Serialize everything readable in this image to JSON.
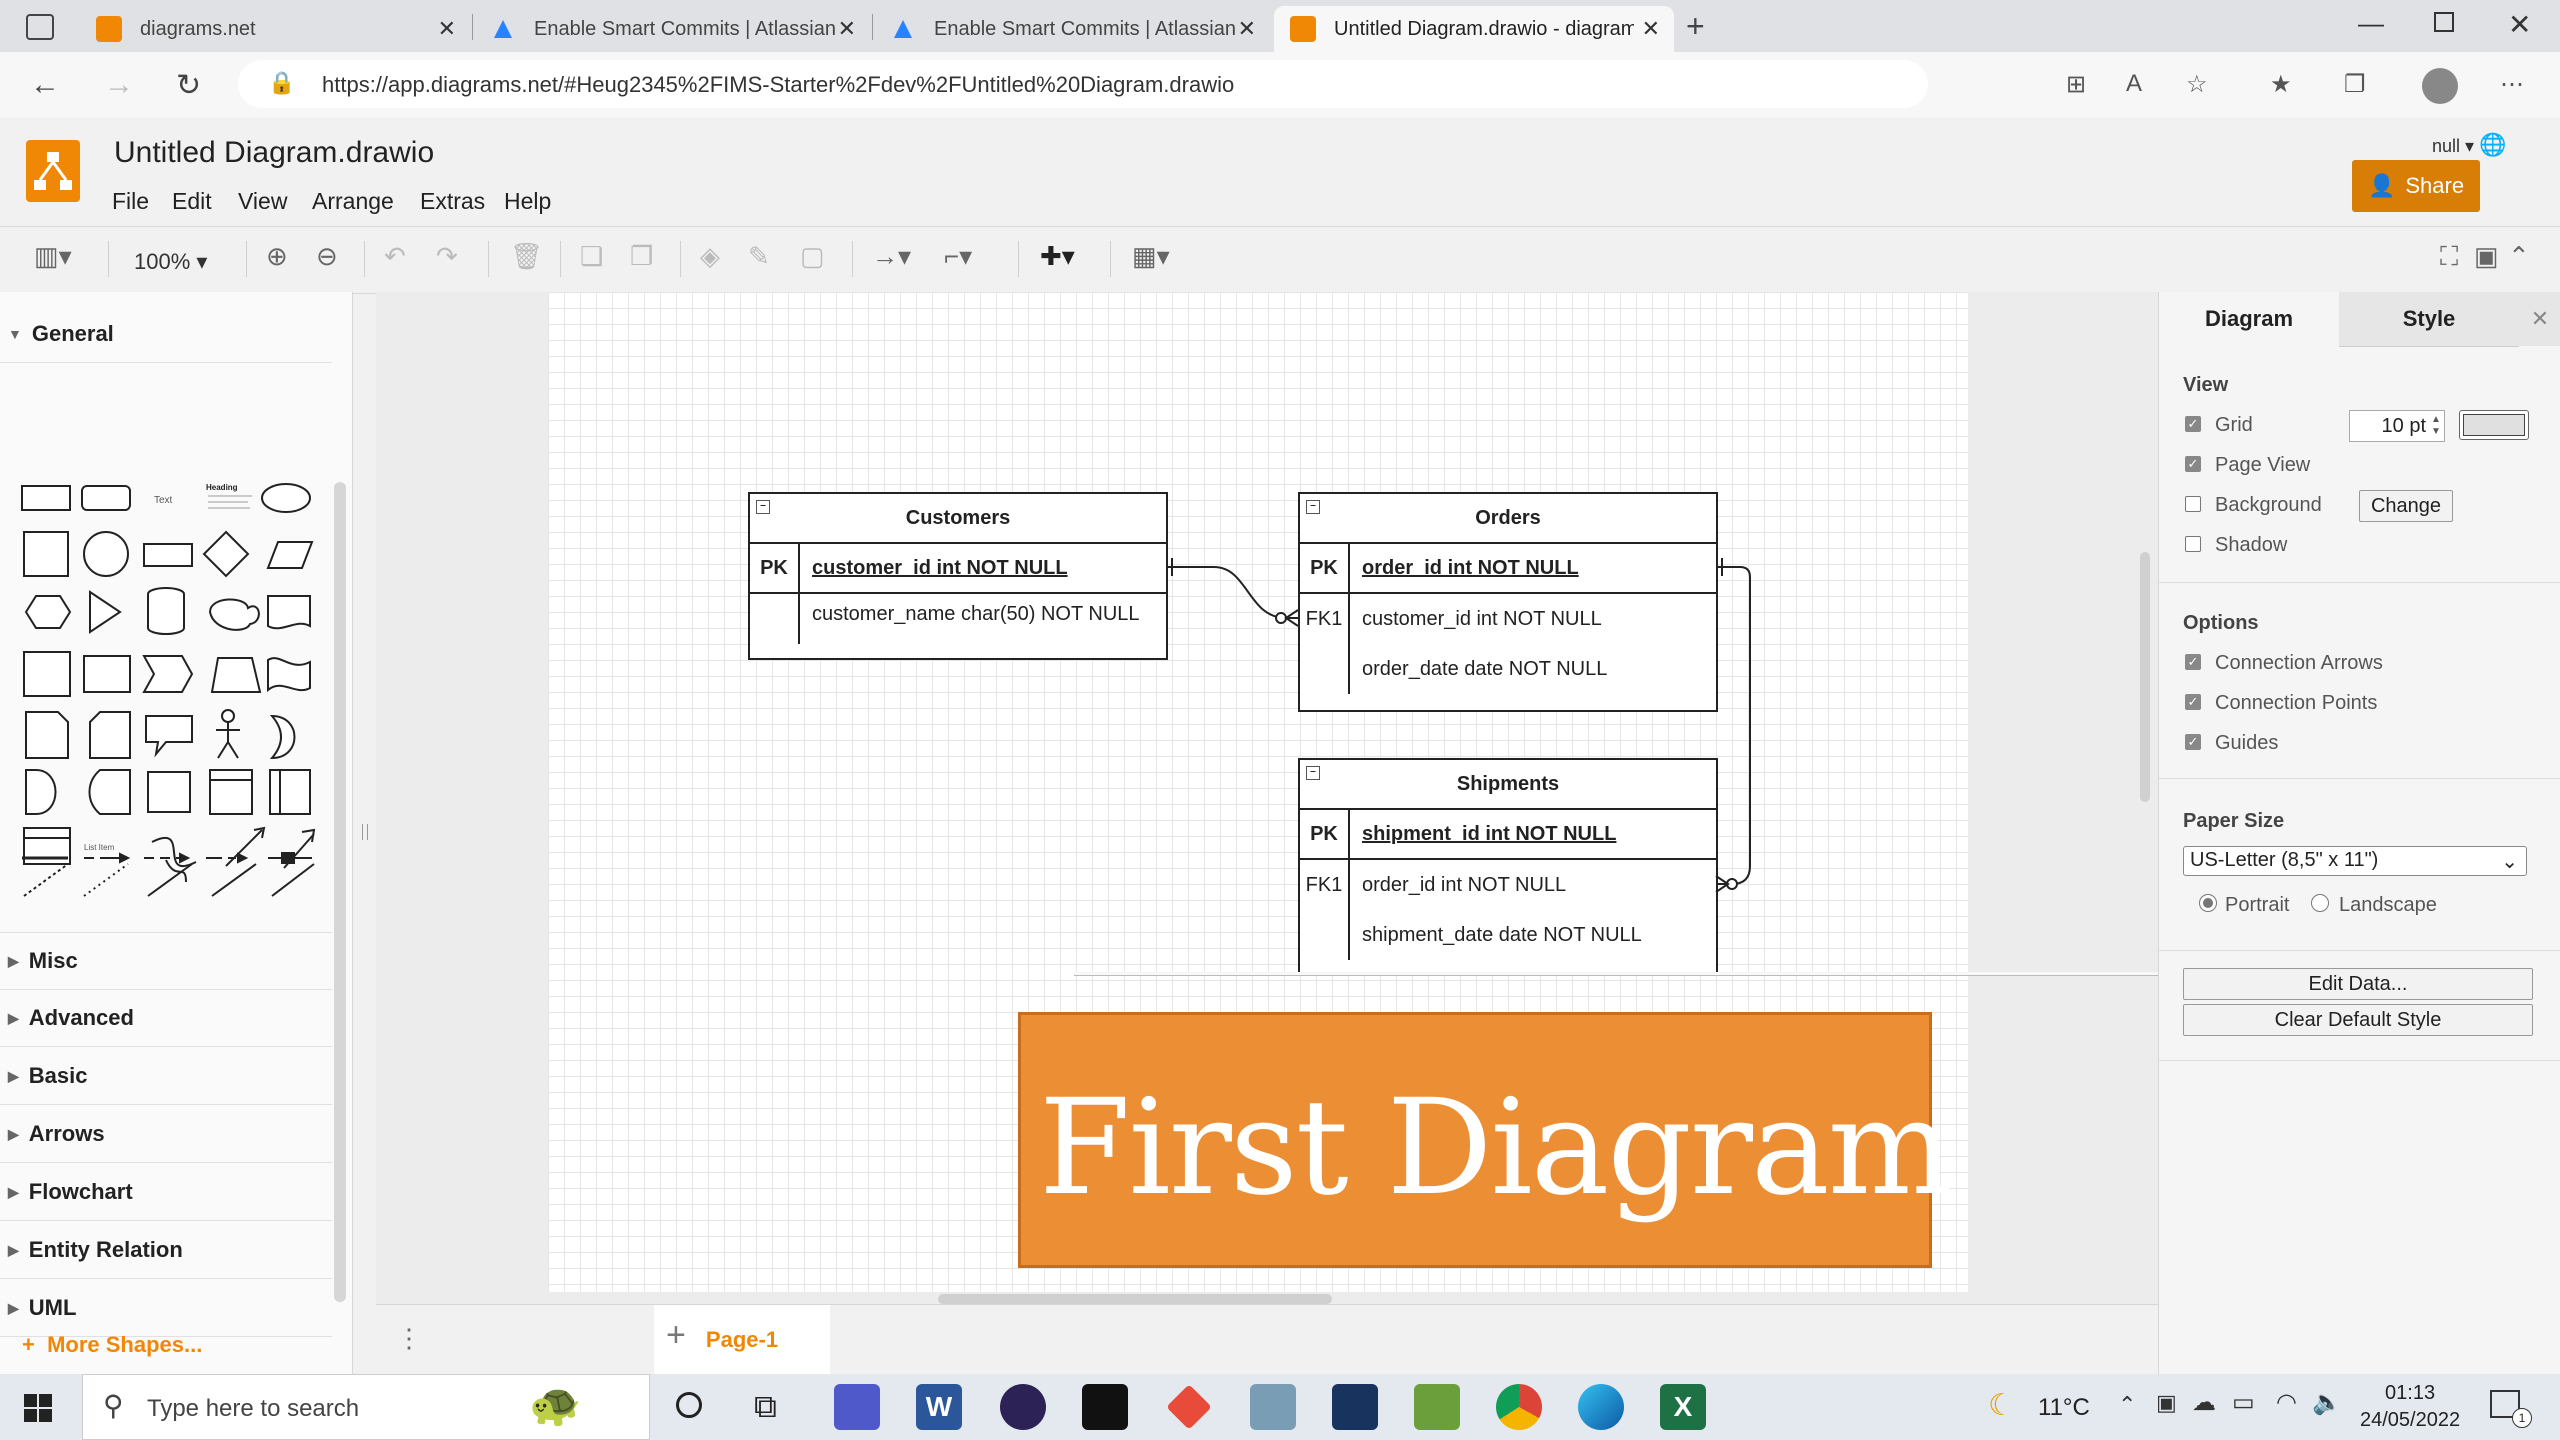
{
  "browser": {
    "tabs": [
      {
        "label": "diagrams.net",
        "active": false
      },
      {
        "label": "Enable Smart Commits | Atlassian",
        "active": false
      },
      {
        "label": "Enable Smart Commits | Atlassian",
        "active": false
      },
      {
        "label": "Untitled Diagram.drawio - diagrams",
        "active": true
      }
    ],
    "url": "https://app.diagrams.net/#Heug2345%2FIMS-Starter%2Fdev%2FUntitled%20Diagram.drawio"
  },
  "app": {
    "title": "Untitled Diagram.drawio",
    "menu": [
      "File",
      "Edit",
      "View",
      "Arrange",
      "Extras",
      "Help"
    ],
    "share_label": "Share",
    "language_selector": "null",
    "zoom": "100%"
  },
  "sidebar": {
    "sections": [
      "General",
      "Misc",
      "Advanced",
      "Basic",
      "Arrows",
      "Flowchart",
      "Entity Relation",
      "UML"
    ],
    "more_shapes": "More Shapes...",
    "shape_text_sample": "Text",
    "shape_heading_sample": "Heading",
    "shape_list_sample": "List Item"
  },
  "diagram": {
    "tables": [
      {
        "name": "Customers",
        "rows": [
          {
            "key": "PK",
            "field": "customer_id int NOT NULL",
            "primary": true
          },
          {
            "key": "",
            "field": "customer_name char(50) NOT NULL",
            "primary": false
          }
        ]
      },
      {
        "name": "Orders",
        "rows": [
          {
            "key": "PK",
            "field": "order_id int NOT NULL",
            "primary": true
          },
          {
            "key": "FK1",
            "field": "customer_id int NOT NULL",
            "primary": false
          },
          {
            "key": "",
            "field": "order_date date NOT NULL",
            "primary": false
          }
        ]
      },
      {
        "name": "Shipments",
        "rows": [
          {
            "key": "PK",
            "field": "shipment_id int NOT NULL",
            "primary": true
          },
          {
            "key": "FK1",
            "field": "order_id int NOT NULL",
            "primary": false
          },
          {
            "key": "",
            "field": "shipment_date date NOT NULL",
            "primary": false
          }
        ]
      }
    ],
    "banner_text": "First Diagram",
    "banner_color": "#ec8f34"
  },
  "right_panel": {
    "tabs": [
      "Diagram",
      "Style"
    ],
    "view_heading": "View",
    "view_options": [
      {
        "label": "Grid",
        "checked": true
      },
      {
        "label": "Page View",
        "checked": true
      },
      {
        "label": "Background",
        "checked": false
      },
      {
        "label": "Shadow",
        "checked": false
      }
    ],
    "grid_size": "10 pt",
    "background_button": "Change",
    "options_heading": "Options",
    "options": [
      {
        "label": "Connection Arrows",
        "checked": true
      },
      {
        "label": "Connection Points",
        "checked": true
      },
      {
        "label": "Guides",
        "checked": true
      }
    ],
    "paper_size_heading": "Paper Size",
    "paper_size": "US-Letter (8,5\" x 11\")",
    "orientation": {
      "portrait": "Portrait",
      "landscape": "Landscape",
      "selected": "Portrait"
    },
    "edit_data": "Edit Data...",
    "clear_style": "Clear Default Style"
  },
  "page_tabs": {
    "current": "Page-1"
  },
  "taskbar": {
    "search_placeholder": "Type here to search",
    "weather": "11°C",
    "time": "01:13",
    "date": "24/05/2022",
    "notification_count": "1"
  },
  "colors": {
    "accent": "#f08705",
    "share_button": "#d87e06"
  }
}
